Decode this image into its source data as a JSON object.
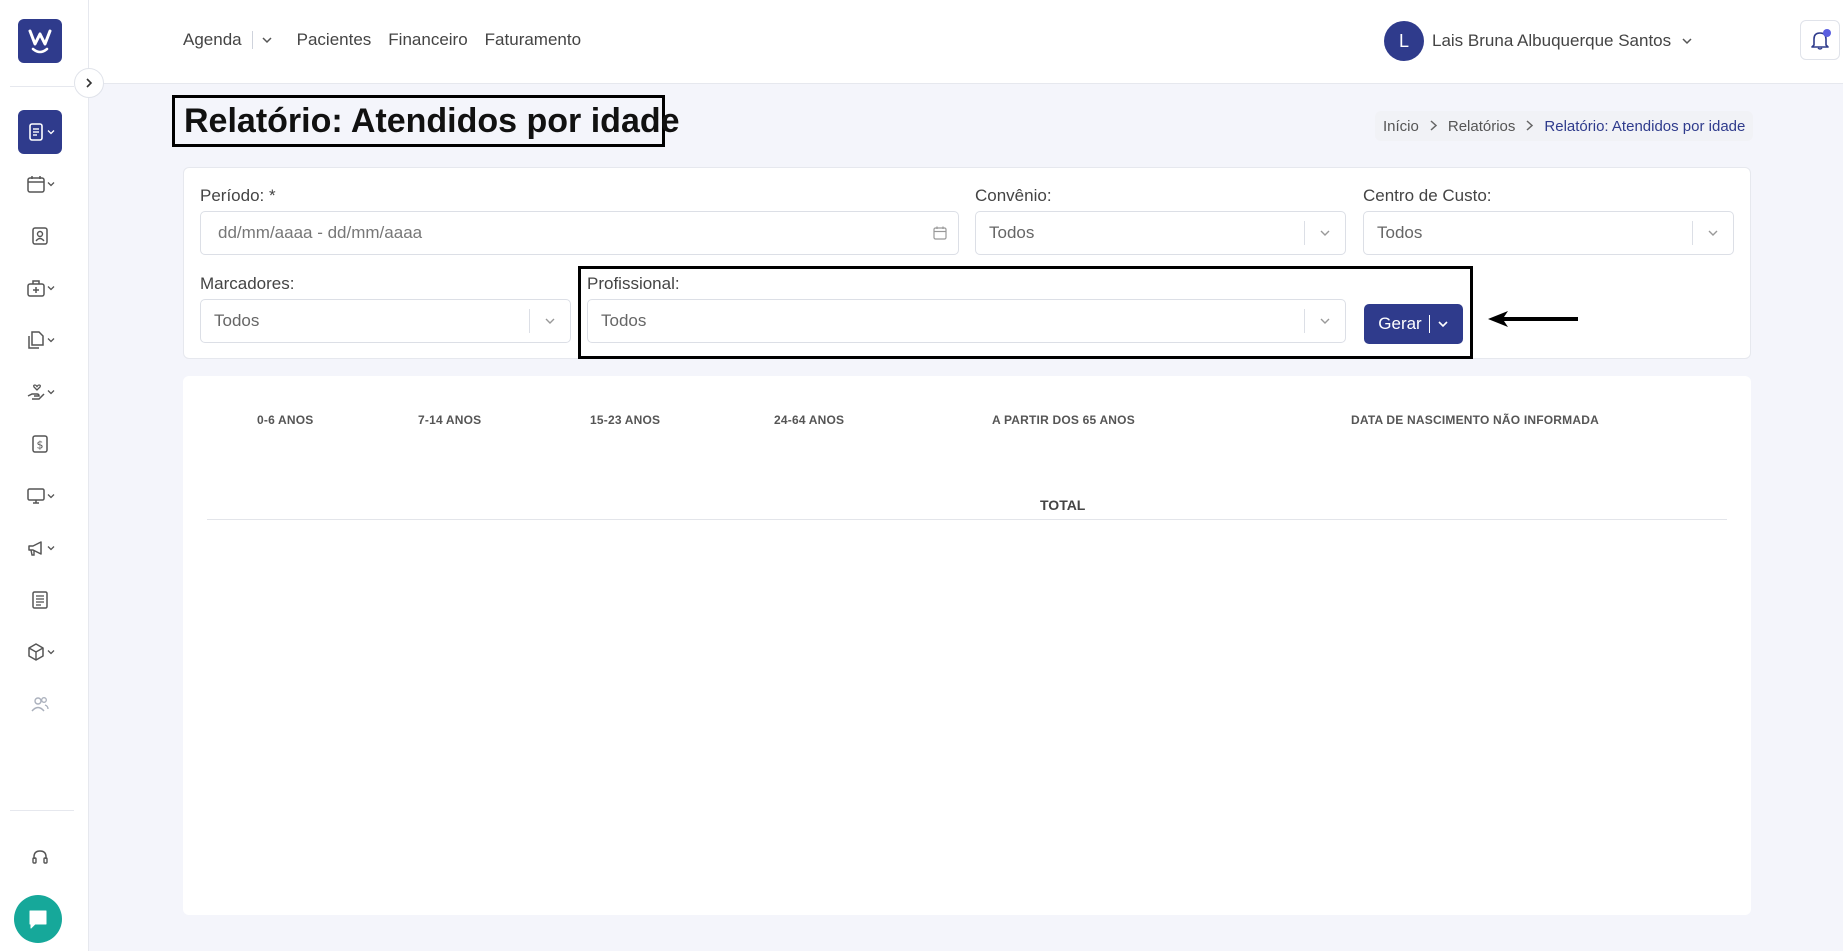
{
  "header": {
    "nav": [
      "Agenda",
      "Pacientes",
      "Financeiro",
      "Faturamento"
    ],
    "user_initial": "L",
    "user_name": "Lais Bruna Albuquerque Santos"
  },
  "page": {
    "title": "Relatório: Atendidos por idade",
    "breadcrumb": [
      "Início",
      "Relatórios",
      "Relatório: Atendidos por idade"
    ]
  },
  "filters": {
    "periodo": {
      "label": "Período: *",
      "placeholder": "dd/mm/aaaa - dd/mm/aaaa"
    },
    "convenio": {
      "label": "Convênio:",
      "value": "Todos"
    },
    "centro_custo": {
      "label": "Centro de Custo:",
      "value": "Todos"
    },
    "marcadores": {
      "label": "Marcadores:",
      "value": "Todos"
    },
    "profissional": {
      "label": "Profissional:",
      "value": "Todos"
    },
    "gerar_label": "Gerar"
  },
  "table": {
    "columns": [
      "0-6 ANOS",
      "7-14 ANOS",
      "15-23 ANOS",
      "24-64 ANOS",
      "A PARTIR DOS 65 ANOS",
      "DATA DE NASCIMENTO NÃO INFORMADA"
    ],
    "total_label": "TOTAL"
  },
  "colors": {
    "brand": "#2f3b8c",
    "chat": "#16a89a",
    "background": "#f4f5fb"
  }
}
